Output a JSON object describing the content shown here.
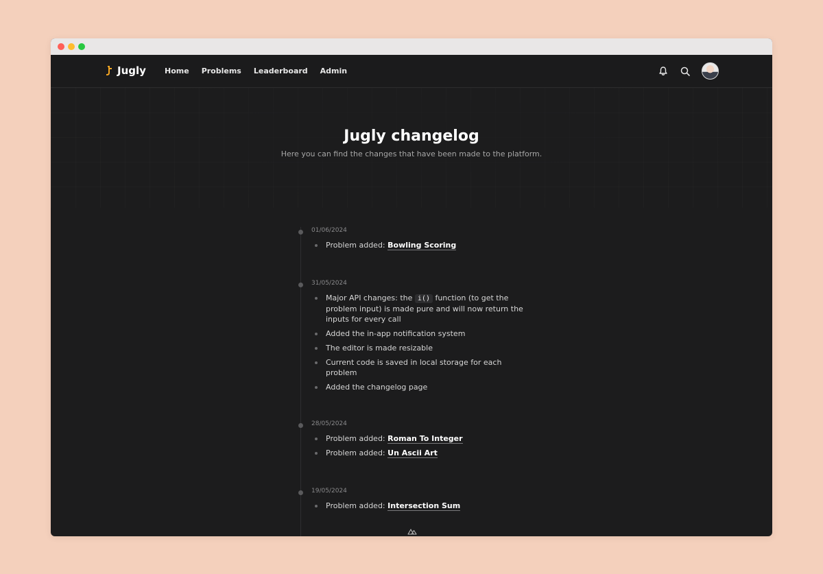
{
  "app": {
    "brand": "Jugly",
    "nav": [
      "Home",
      "Problems",
      "Leaderboard",
      "Admin"
    ],
    "brand_color": "#f5a623"
  },
  "hero": {
    "title": "Jugly changelog",
    "subtitle": "Here you can find the changes that have been made to the platform."
  },
  "changelog": [
    {
      "date": "01/06/2024",
      "items": [
        {
          "prefix": "Problem added: ",
          "link": "Bowling Scoring"
        }
      ]
    },
    {
      "date": "31/05/2024",
      "items": [
        {
          "before": "Major API changes: the ",
          "code": "i()",
          "after": " function (to get the problem input) is made pure and will now return the inputs for every call"
        },
        {
          "text": "Added the in-app notification system"
        },
        {
          "text": "The editor is made resizable"
        },
        {
          "text": "Current code is saved in local storage for each problem"
        },
        {
          "text": "Added the changelog page"
        }
      ]
    },
    {
      "date": "28/05/2024",
      "items": [
        {
          "prefix": "Problem added: ",
          "link": "Roman To Integer"
        },
        {
          "prefix": "Problem added: ",
          "link": "Un Ascii Art"
        }
      ]
    },
    {
      "date": "19/05/2024",
      "items": [
        {
          "prefix": "Problem added: ",
          "link": "Intersection Sum"
        }
      ]
    }
  ]
}
